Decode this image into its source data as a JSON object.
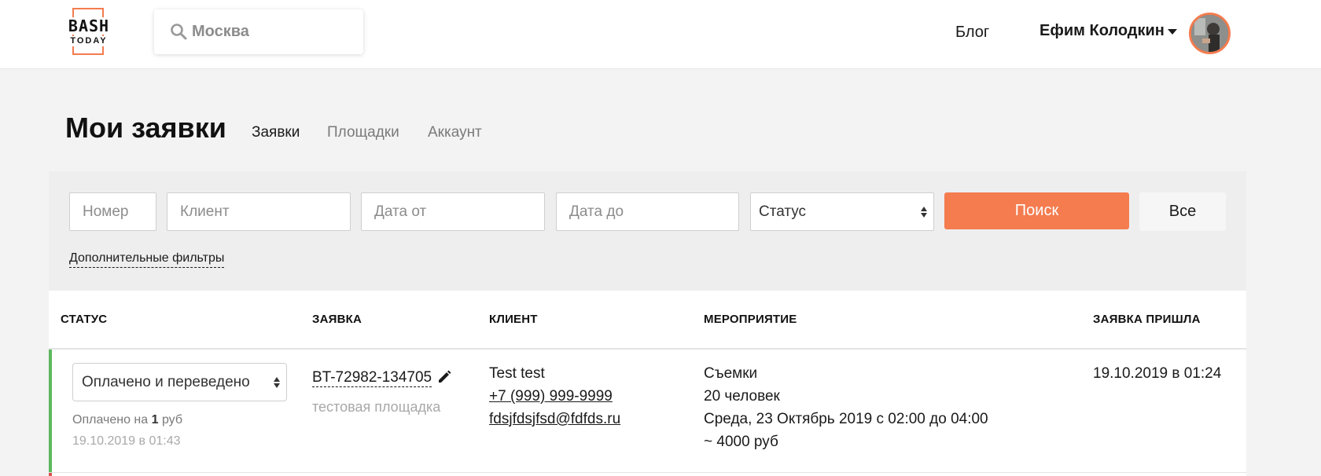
{
  "header": {
    "logo": {
      "line1": "BASH",
      "line2": "TODAY"
    },
    "search": {
      "placeholder": "Москва",
      "icon": "search-icon"
    },
    "nav": {
      "blog": "Блог"
    },
    "user": {
      "name": "Ефим Колодкин",
      "caret_icon": "caret-down-icon"
    }
  },
  "page": {
    "title": "Мои заявки",
    "tabs": [
      {
        "label": "Заявки",
        "active": true
      },
      {
        "label": "Площадки",
        "active": false
      },
      {
        "label": "Аккаунт",
        "active": false
      }
    ]
  },
  "filters": {
    "number_placeholder": "Номер",
    "client_placeholder": "Клиент",
    "date_from_placeholder": "Дата от",
    "date_to_placeholder": "Дата до",
    "status_value": "Статус",
    "search_button": "Поиск",
    "all_button": "Все",
    "extra_filters": "Дополнительные фильтры"
  },
  "table": {
    "headers": [
      "СТАТУС",
      "ЗАЯВКА",
      "КЛИЕНТ",
      "МЕРОПРИЯТИЕ",
      "ЗАЯВКА ПРИШЛА"
    ],
    "rows": [
      {
        "status": "Оплачено и переведено",
        "paid_prefix": "Оплачено на ",
        "paid_amount": "1",
        "paid_suffix": " руб",
        "paid_date": "19.10.2019 в 01:43",
        "order_id": "BT-72982-134705",
        "venue": "тестовая площадка",
        "client_name": "Test test",
        "client_phone": "+7 (999) 999-9999",
        "client_email": "fdsjfdsjfsd@fdfds.ru",
        "event_type": "Съемки",
        "event_guests": "20 человек",
        "event_date": "Среда, 23 Октябрь 2019 с 02:00 до 04:00",
        "event_budget": "~ 4000 руб",
        "received": "19.10.2019 в 01:24"
      }
    ]
  },
  "colors": {
    "accent": "#f47c4f",
    "paid_status": "#5cb85c",
    "next_row_status": "#d9534f"
  }
}
